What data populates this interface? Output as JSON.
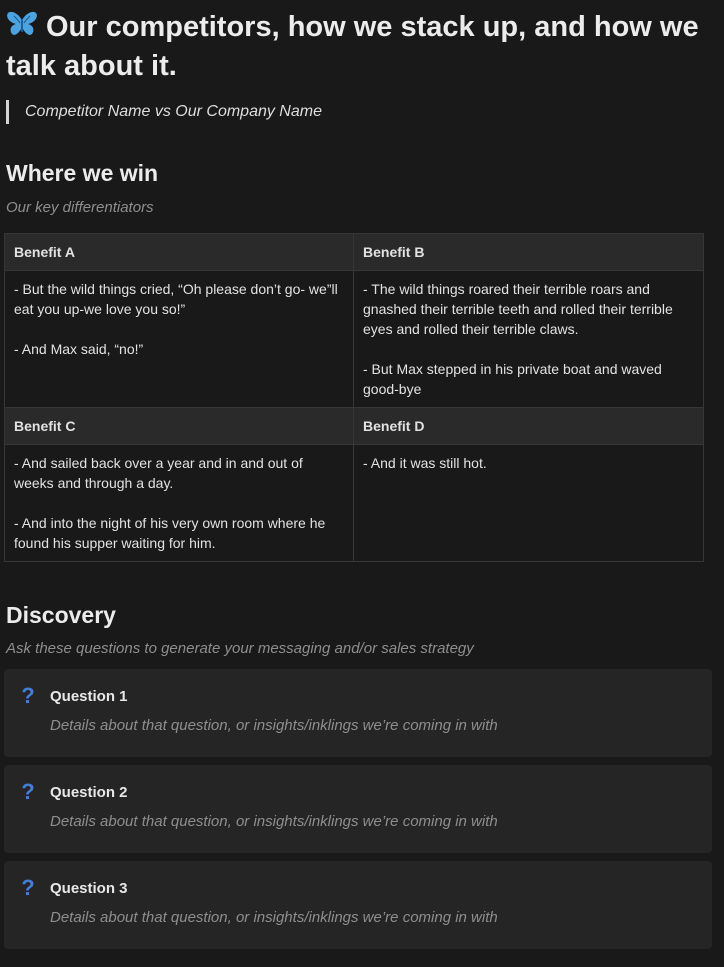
{
  "header": {
    "icon": "butterfly-icon",
    "title": "Our competitors, how we stack up, and how we talk about it.",
    "quote": "Competitor Name vs Our Company Name"
  },
  "win_section": {
    "heading": "Where we win",
    "subtitle": "Our key differentiators",
    "cells": [
      {
        "title": "Benefit A",
        "lines": [
          "- But the wild things cried, “Oh please don’t go- we”ll eat you up-we love you so!”",
          "- And Max said, “no!”"
        ]
      },
      {
        "title": "Benefit B",
        "lines": [
          "- The wild things roared their terrible roars and gnashed their terrible teeth and rolled their terrible eyes and rolled their terrible claws.",
          "- But Max stepped in his private boat and waved good-bye"
        ]
      },
      {
        "title": "Benefit C",
        "lines": [
          "- And sailed back over a year and in and out of weeks and through a day.",
          "- And into the night of his very own room where he found his supper waiting for him."
        ]
      },
      {
        "title": "Benefit D",
        "lines": [
          "- And it was still hot."
        ]
      }
    ]
  },
  "discovery_section": {
    "heading": "Discovery",
    "subtitle": "Ask these questions to generate your messaging and/or sales strategy",
    "icon": "question-mark-icon",
    "icon_glyph": "?",
    "icon_color": "#3f7fd6",
    "questions": [
      {
        "title": "Question 1",
        "detail": "Details about that question, or insights/inklings we’re coming in with"
      },
      {
        "title": "Question 2",
        "detail": "Details about that question, or insights/inklings we’re coming in with"
      },
      {
        "title": "Question 3",
        "detail": "Details about that question, or insights/inklings we’re coming in with"
      }
    ]
  }
}
